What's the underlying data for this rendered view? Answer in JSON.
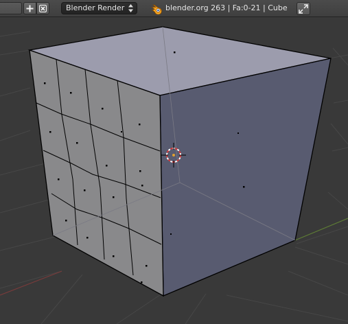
{
  "header": {
    "add_label": "+",
    "delete_label": "×",
    "render_engine": "Blender Render",
    "stats": "blender.org 263 | Fa:0-21 | Cube",
    "icons": {
      "add": "plus-icon",
      "delete": "x-icon",
      "engine_arrows": "up-down-arrows-icon",
      "logo": "blender-logo-icon",
      "fullscreen": "maximize-icon"
    }
  },
  "viewport": {
    "object_name": "Cube",
    "mode": "Edit Mode",
    "face_select_range": "Fa:0-21",
    "colors": {
      "background": "#393939",
      "grid": "#484848",
      "x_axis": "#8b3a3a",
      "y_axis": "#6b8f3b",
      "face_top": "#9b9bac",
      "face_right": "#585b6f",
      "face_front": "#88888a",
      "edge": "#000000",
      "cursor_ring": "#cc3333"
    },
    "icons": {
      "cursor": "3d-cursor-icon"
    }
  }
}
